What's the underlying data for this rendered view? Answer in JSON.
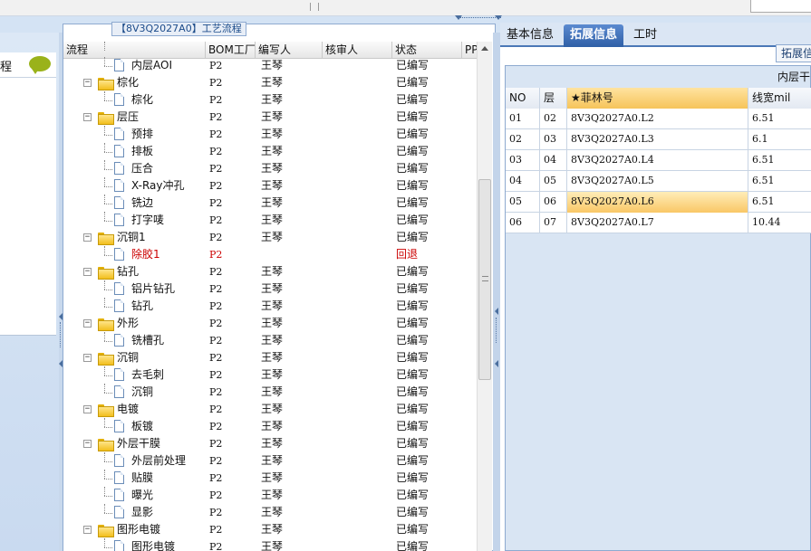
{
  "left_panel": {
    "title": "程"
  },
  "main_panel": {
    "title": "【8V3Q2027A0】工艺流程",
    "columns": [
      "流程",
      "BOM工厂",
      "编写人",
      "核审人",
      "状态",
      "PP"
    ],
    "rows": [
      {
        "name": "内层AOI",
        "type": "doc",
        "bom": "P2",
        "writer": "王琴",
        "status": "已编写"
      },
      {
        "name": "棕化",
        "type": "folder",
        "bom": "P2",
        "writer": "王琴",
        "status": "已编写"
      },
      {
        "name": "棕化",
        "type": "doc",
        "bom": "P2",
        "writer": "王琴",
        "status": "已编写"
      },
      {
        "name": "层压",
        "type": "folder",
        "bom": "P2",
        "writer": "王琴",
        "status": "已编写"
      },
      {
        "name": "预排",
        "type": "doc",
        "bom": "P2",
        "writer": "王琴",
        "status": "已编写"
      },
      {
        "name": "排板",
        "type": "doc",
        "bom": "P2",
        "writer": "王琴",
        "status": "已编写"
      },
      {
        "name": "压合",
        "type": "doc",
        "bom": "P2",
        "writer": "王琴",
        "status": "已编写"
      },
      {
        "name": "X-Ray冲孔",
        "type": "doc",
        "bom": "P2",
        "writer": "王琴",
        "status": "已编写"
      },
      {
        "name": "铣边",
        "type": "doc",
        "bom": "P2",
        "writer": "王琴",
        "status": "已编写"
      },
      {
        "name": "打字唛",
        "type": "doc",
        "bom": "P2",
        "writer": "王琴",
        "status": "已编写"
      },
      {
        "name": "沉铜1",
        "type": "folder",
        "bom": "P2",
        "writer": "王琴",
        "status": "已编写"
      },
      {
        "name": "除胶1",
        "type": "doc",
        "bom": "P2",
        "writer": "",
        "status": "回退",
        "red": true
      },
      {
        "name": "钻孔",
        "type": "folder",
        "bom": "P2",
        "writer": "王琴",
        "status": "已编写"
      },
      {
        "name": "铝片钻孔",
        "type": "doc",
        "bom": "P2",
        "writer": "王琴",
        "status": "已编写"
      },
      {
        "name": "钻孔",
        "type": "doc",
        "bom": "P2",
        "writer": "王琴",
        "status": "已编写"
      },
      {
        "name": "外形",
        "type": "folder",
        "bom": "P2",
        "writer": "王琴",
        "status": "已编写"
      },
      {
        "name": "铣槽孔",
        "type": "doc",
        "bom": "P2",
        "writer": "王琴",
        "status": "已编写"
      },
      {
        "name": "沉铜",
        "type": "folder",
        "bom": "P2",
        "writer": "王琴",
        "status": "已编写"
      },
      {
        "name": "去毛刺",
        "type": "doc",
        "bom": "P2",
        "writer": "王琴",
        "status": "已编写"
      },
      {
        "name": "沉铜",
        "type": "doc",
        "bom": "P2",
        "writer": "王琴",
        "status": "已编写"
      },
      {
        "name": "电镀",
        "type": "folder",
        "bom": "P2",
        "writer": "王琴",
        "status": "已编写"
      },
      {
        "name": "板镀",
        "type": "doc",
        "bom": "P2",
        "writer": "王琴",
        "status": "已编写"
      },
      {
        "name": "外层干膜",
        "type": "folder",
        "bom": "P2",
        "writer": "王琴",
        "status": "已编写"
      },
      {
        "name": "外层前处理",
        "type": "doc",
        "bom": "P2",
        "writer": "王琴",
        "status": "已编写"
      },
      {
        "name": "贴膜",
        "type": "doc",
        "bom": "P2",
        "writer": "王琴",
        "status": "已编写"
      },
      {
        "name": "曝光",
        "type": "doc",
        "bom": "P2",
        "writer": "王琴",
        "status": "已编写"
      },
      {
        "name": "显影",
        "type": "doc",
        "bom": "P2",
        "writer": "王琴",
        "status": "已编写"
      },
      {
        "name": "图形电镀",
        "type": "folder",
        "bom": "P2",
        "writer": "王琴",
        "status": "已编写"
      },
      {
        "name": "图形电镀",
        "type": "doc",
        "bom": "P2",
        "writer": "王琴",
        "status": "已编写"
      }
    ]
  },
  "right_panel": {
    "tabs": [
      "基本信息",
      "拓展信息",
      "工时"
    ],
    "active_tab": 1,
    "ext_button": "拓展信",
    "subtitle": "内层干",
    "columns": [
      "NO",
      "层",
      "★菲林号",
      "线宽mil"
    ],
    "rows": [
      {
        "no": "01",
        "layer": "02",
        "film": "8V3Q2027A0.L2",
        "width": "6.51"
      },
      {
        "no": "02",
        "layer": "03",
        "film": "8V3Q2027A0.L3",
        "width": "6.1"
      },
      {
        "no": "03",
        "layer": "04",
        "film": "8V3Q2027A0.L4",
        "width": "6.51"
      },
      {
        "no": "04",
        "layer": "05",
        "film": "8V3Q2027A0.L5",
        "width": "6.51"
      },
      {
        "no": "05",
        "layer": "06",
        "film": "8V3Q2027A0.L6",
        "width": "6.51",
        "selected": true
      },
      {
        "no": "06",
        "layer": "07",
        "film": "8V3Q2027A0.L7",
        "width": "10.44"
      }
    ]
  }
}
